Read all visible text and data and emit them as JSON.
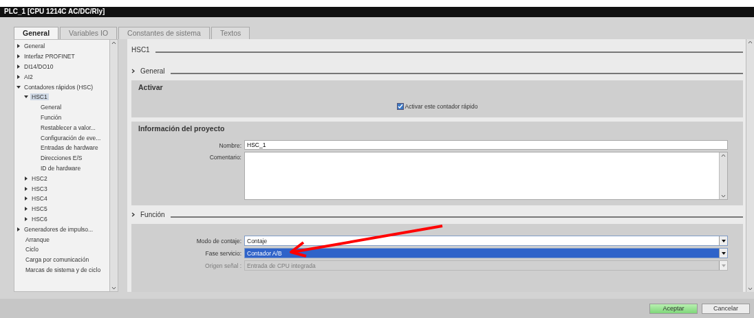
{
  "window": {
    "title": "PLC_1 [CPU 1214C AC/DC/Rly]"
  },
  "tabs": [
    {
      "label": "General",
      "selected": true
    },
    {
      "label": "Variables IO",
      "selected": false
    },
    {
      "label": "Constantes de sistema",
      "selected": false
    },
    {
      "label": "Textos",
      "selected": false
    }
  ],
  "tree": [
    {
      "label": "General",
      "kind": "group",
      "expanded": false,
      "selected": false
    },
    {
      "label": "Interfaz PROFINET",
      "kind": "group",
      "expanded": false,
      "selected": false
    },
    {
      "label": "DI14/DO10",
      "kind": "group",
      "expanded": false,
      "selected": false
    },
    {
      "label": "AI2",
      "kind": "group",
      "expanded": false,
      "selected": false
    },
    {
      "label": "Contadores rápidos (HSC)",
      "kind": "group",
      "expanded": true,
      "selected": false,
      "children": [
        {
          "label": "HSC1",
          "kind": "group",
          "expanded": true,
          "selected": true,
          "children": [
            {
              "label": "General",
              "kind": "leaf",
              "selected": false
            },
            {
              "label": "Función",
              "kind": "leaf",
              "selected": false
            },
            {
              "label": "Restablecer a valor...",
              "kind": "leaf",
              "selected": false
            },
            {
              "label": "Configuración de eve...",
              "kind": "leaf",
              "selected": false
            },
            {
              "label": "Entradas de hardware",
              "kind": "leaf",
              "selected": false
            },
            {
              "label": "Direcciones E/S",
              "kind": "leaf",
              "selected": false
            },
            {
              "label": "ID de hardware",
              "kind": "leaf",
              "selected": false
            }
          ]
        },
        {
          "label": "HSC2",
          "kind": "group",
          "expanded": false,
          "selected": false
        },
        {
          "label": "HSC3",
          "kind": "group",
          "expanded": false,
          "selected": false
        },
        {
          "label": "HSC4",
          "kind": "group",
          "expanded": false,
          "selected": false
        },
        {
          "label": "HSC5",
          "kind": "group",
          "expanded": false,
          "selected": false
        },
        {
          "label": "HSC6",
          "kind": "group",
          "expanded": false,
          "selected": false
        }
      ]
    },
    {
      "label": "Generadores de impulso...",
      "kind": "group",
      "expanded": false,
      "selected": false
    },
    {
      "label": "Arranque",
      "kind": "leaf",
      "selected": false
    },
    {
      "label": "Ciclo",
      "kind": "leaf",
      "selected": false
    },
    {
      "label": "Carga por comunicación",
      "kind": "leaf",
      "selected": false
    },
    {
      "label": "Marcas de sistema y de ciclo",
      "kind": "leaf",
      "selected": false
    }
  ],
  "content": {
    "title": "HSC1",
    "groups": [
      {
        "heading": "General",
        "panels": [
          {
            "title": "Activar",
            "rows": [
              {
                "kind": "checkbox",
                "label": "Activar este contador rápido",
                "checked": true
              }
            ]
          },
          {
            "title": "Información del proyecto",
            "rows": [
              {
                "kind": "text",
                "label": "Nombre:",
                "value": "HSC_1"
              },
              {
                "kind": "textarea",
                "label": "Comentario:"
              }
            ]
          }
        ]
      },
      {
        "heading": "Función",
        "panels": [
          {
            "rows": [
              {
                "kind": "dropdown",
                "label": "Modo de contaje:",
                "value": "Contaje",
                "selected": false,
                "disabled": false
              },
              {
                "kind": "dropdown",
                "label": "Fase servicio:",
                "value": "Contador A/B",
                "selected": true,
                "disabled": false
              },
              {
                "kind": "dropdown",
                "label": "Origen señal :",
                "value": "Entrada de CPU integrada",
                "selected": false,
                "disabled": true
              }
            ]
          }
        ]
      }
    ]
  },
  "buttons": [
    {
      "label": "Aceptar",
      "kind": "primary"
    },
    {
      "label": "Cancelar",
      "kind": "secondary"
    }
  ]
}
